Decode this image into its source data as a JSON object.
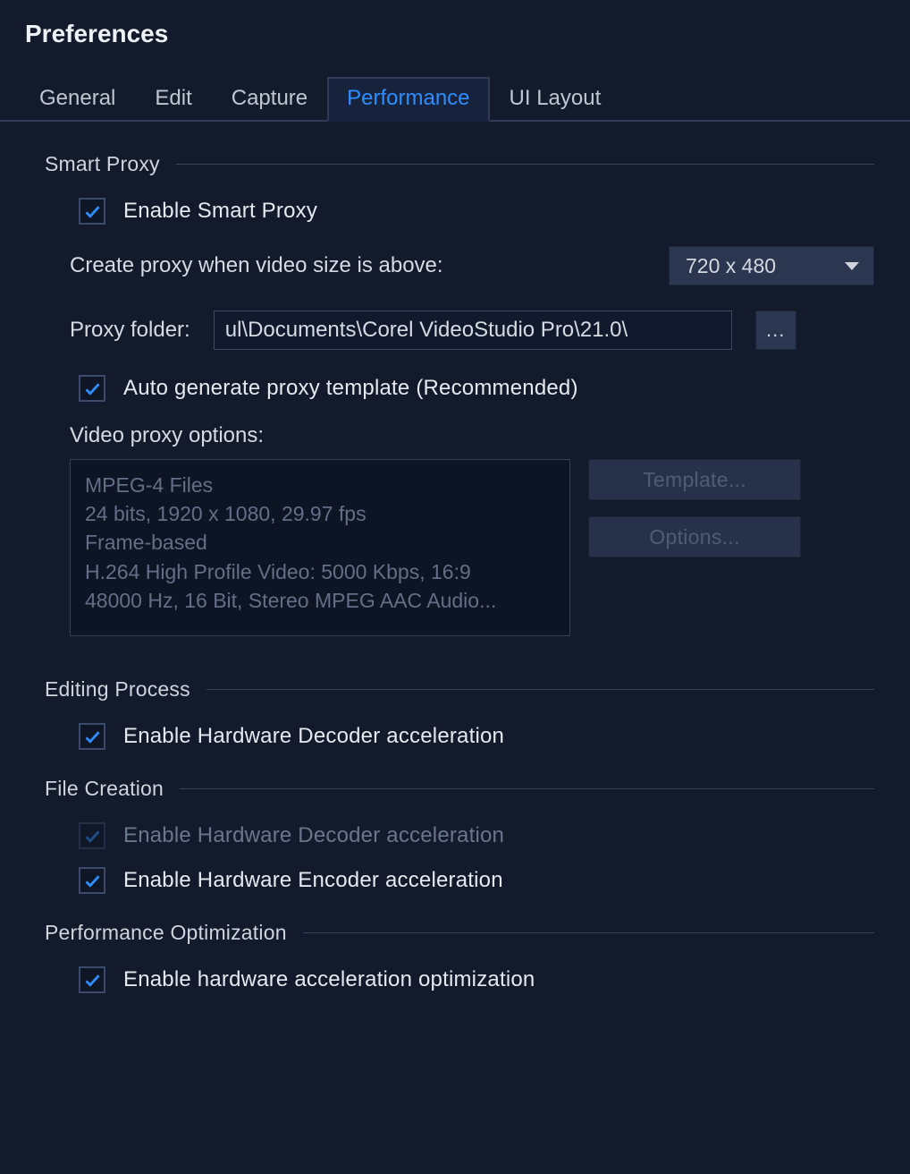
{
  "title": "Preferences",
  "tabs": {
    "general": "General",
    "edit": "Edit",
    "capture": "Capture",
    "performance": "Performance",
    "ui_layout": "UI Layout",
    "active": "performance"
  },
  "sections": {
    "smart_proxy": {
      "title": "Smart Proxy",
      "enable_label": "Enable Smart Proxy",
      "enable_checked": true,
      "create_when_label": "Create proxy when video size is above:",
      "size_selected": "720 x 480",
      "proxy_folder_label": "Proxy folder:",
      "proxy_folder_value": "ul\\Documents\\Corel VideoStudio Pro\\21.0\\",
      "browse_label": "...",
      "auto_template_label": "Auto generate proxy template (Recommended)",
      "auto_template_checked": true,
      "video_proxy_options_label": "Video proxy options:",
      "options_lines": {
        "l1": "MPEG-4 Files",
        "l2": "24 bits, 1920 x 1080, 29.97 fps",
        "l3": "Frame-based",
        "l4": "H.264 High Profile Video: 5000 Kbps, 16:9",
        "l5": "48000 Hz, 16 Bit, Stereo MPEG AAC Audio..."
      },
      "template_btn": "Template...",
      "options_btn": "Options..."
    },
    "editing_process": {
      "title": "Editing Process",
      "hw_decoder_label": "Enable Hardware Decoder acceleration",
      "hw_decoder_checked": true
    },
    "file_creation": {
      "title": "File Creation",
      "hw_decoder_label": "Enable Hardware Decoder acceleration",
      "hw_decoder_checked": true,
      "hw_decoder_disabled": true,
      "hw_encoder_label": "Enable Hardware Encoder acceleration",
      "hw_encoder_checked": true
    },
    "performance_opt": {
      "title": "Performance Optimization",
      "hw_accel_label": "Enable hardware acceleration optimization",
      "hw_accel_checked": true
    }
  }
}
